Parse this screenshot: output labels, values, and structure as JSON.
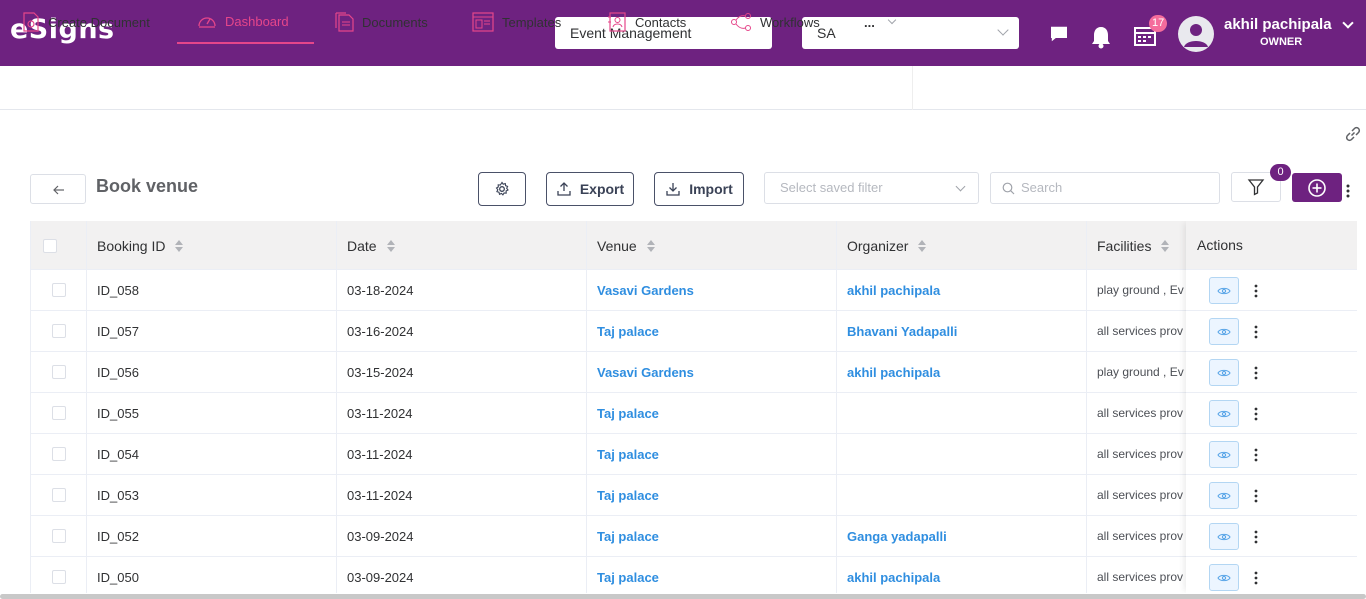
{
  "header": {
    "logo": "eSigns",
    "app_selector": "Event Management",
    "workspace_selector": "SA",
    "notifications_count": "17",
    "user_name": "akhil pachipala",
    "user_role": "OWNER"
  },
  "nav": {
    "items": [
      {
        "label": "Create Document"
      },
      {
        "label": "Dashboard"
      },
      {
        "label": "Documents"
      },
      {
        "label": "Templates"
      },
      {
        "label": "Contacts"
      },
      {
        "label": "Workflows"
      },
      {
        "label": "..."
      }
    ],
    "active": "Dashboard"
  },
  "toolbar": {
    "title": "Book venue",
    "export_label": "Export",
    "import_label": "Import",
    "filter_placeholder": "Select saved filter",
    "search_placeholder": "Search",
    "filter_count": "0"
  },
  "table": {
    "columns": [
      "Booking ID",
      "Date",
      "Venue",
      "Organizer",
      "Facilities",
      "Actions"
    ],
    "rows": [
      {
        "id": "ID_058",
        "date": "03-18-2024",
        "venue": "Vasavi Gardens",
        "organizer": "akhil pachipala",
        "facilities": "play ground , Ev"
      },
      {
        "id": "ID_057",
        "date": "03-16-2024",
        "venue": "Taj palace",
        "organizer": "Bhavani Yadapalli",
        "facilities": "all services prov"
      },
      {
        "id": "ID_056",
        "date": "03-15-2024",
        "venue": "Vasavi Gardens",
        "organizer": "akhil pachipala",
        "facilities": "play ground , Ev"
      },
      {
        "id": "ID_055",
        "date": "03-11-2024",
        "venue": "Taj palace",
        "organizer": "",
        "facilities": "all services prov"
      },
      {
        "id": "ID_054",
        "date": "03-11-2024",
        "venue": "Taj palace",
        "organizer": "",
        "facilities": "all services prov"
      },
      {
        "id": "ID_053",
        "date": "03-11-2024",
        "venue": "Taj palace",
        "organizer": "",
        "facilities": "all services prov"
      },
      {
        "id": "ID_052",
        "date": "03-09-2024",
        "venue": "Taj palace",
        "organizer": "Ganga yadapalli",
        "facilities": "all services prov"
      },
      {
        "id": "ID_050",
        "date": "03-09-2024",
        "venue": "Taj palace",
        "organizer": "akhil pachipala",
        "facilities": "all services prov"
      }
    ]
  },
  "colors": {
    "brand": "#6e2280",
    "active_tab": "#e5468a",
    "link": "#2f8ee0",
    "badge": "#f56c9c"
  },
  "icons": [
    "chat-icon",
    "bell-icon",
    "calendar-icon",
    "user-avatar-icon",
    "link-icon",
    "back-arrow-icon",
    "gear-icon",
    "export-icon",
    "import-icon",
    "search-icon",
    "funnel-icon",
    "plus-circle-icon",
    "eye-icon",
    "more-vertical-icon"
  ]
}
